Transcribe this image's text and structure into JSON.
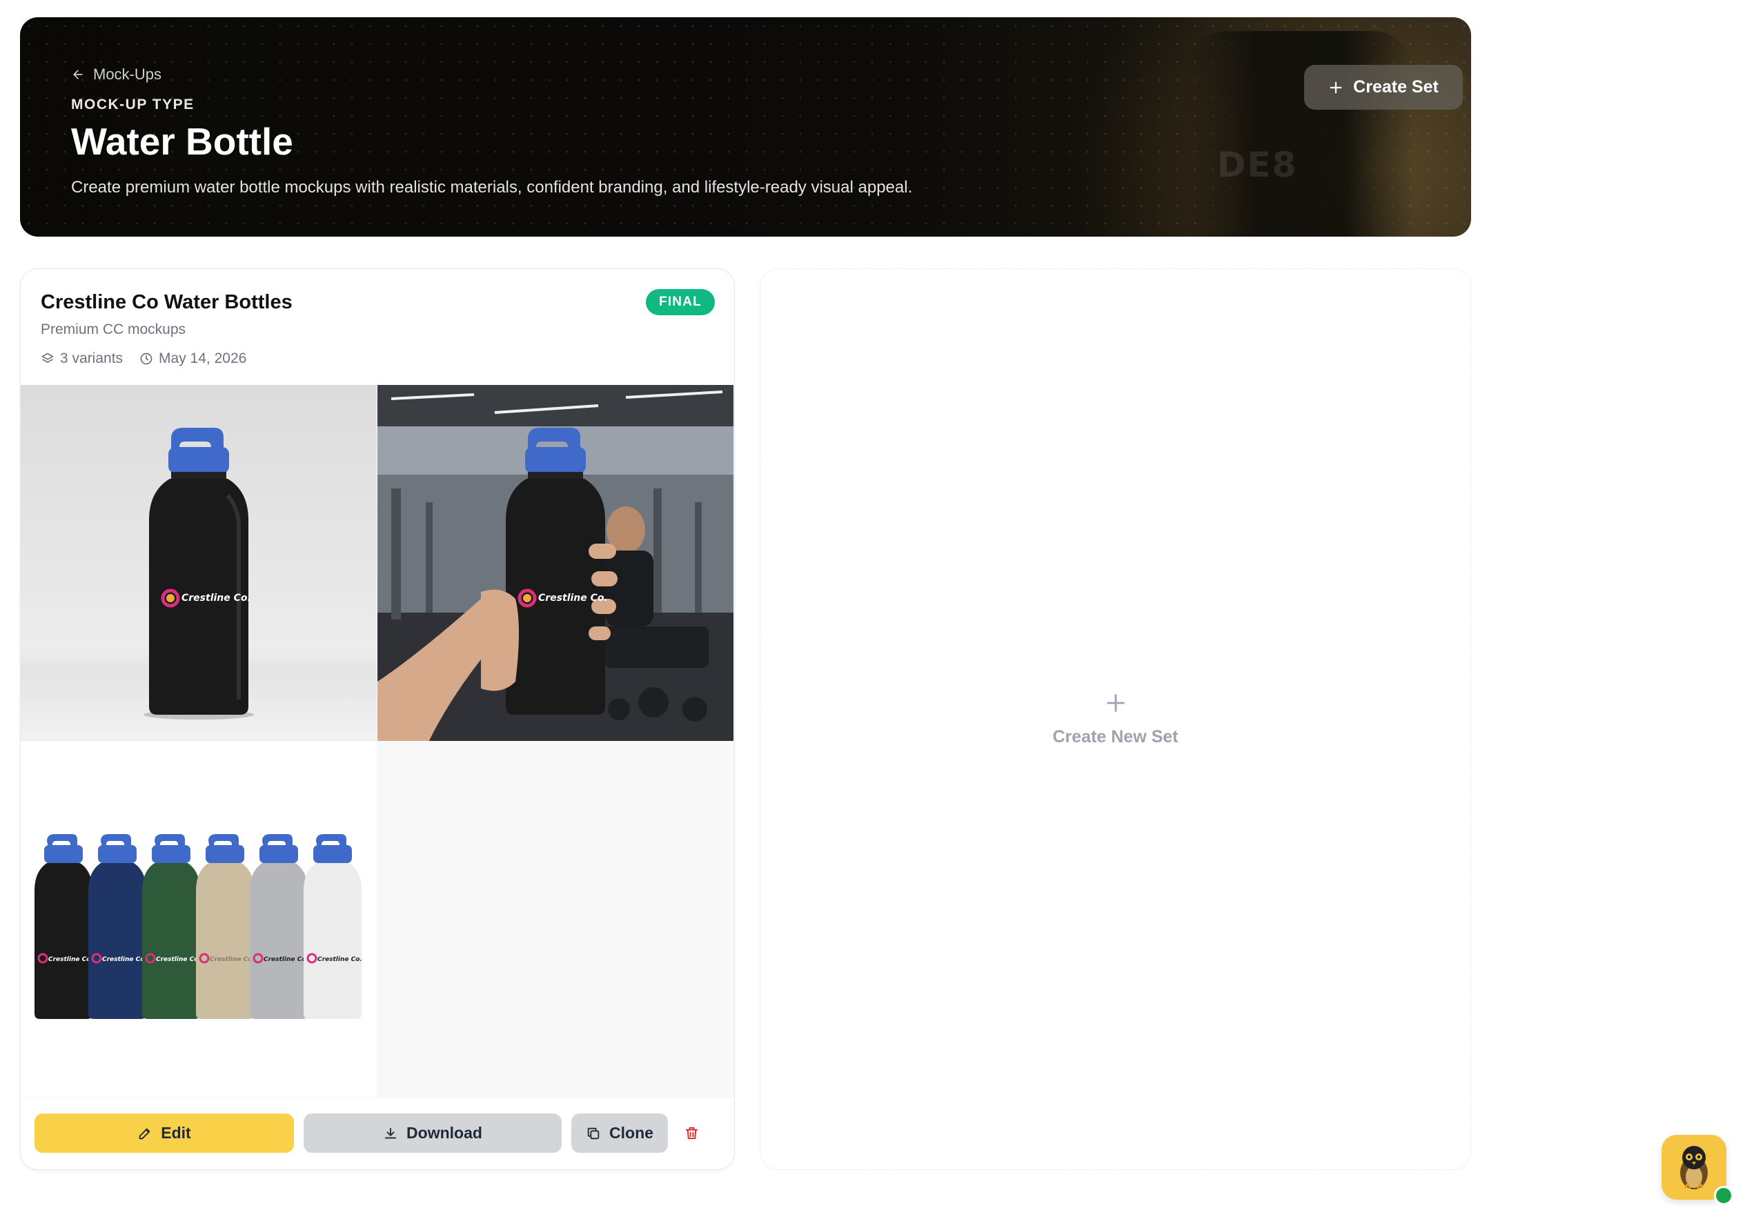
{
  "hero": {
    "back_label": "Mock-Ups",
    "eyebrow": "MOCK-UP TYPE",
    "title": "Water Bottle",
    "description": "Create premium water bottle mockups with realistic materials, confident branding, and lifestyle-ready visual appeal.",
    "create_button": "Create Set",
    "bg_logo_text": "DE8"
  },
  "set_card": {
    "title": "Crestline Co Water Bottles",
    "subtitle": "Premium CC mockups",
    "status": "FINAL",
    "variants": "3 variants",
    "date": "May 14, 2026",
    "brand_label": "Crestline Co.",
    "actions": {
      "edit": "Edit",
      "download": "Download",
      "clone": "Clone"
    }
  },
  "new_set": {
    "label": "Create New Set"
  },
  "colors": {
    "accent_yellow": "#f8d148",
    "status_green": "#10b981",
    "cap_blue": "#3f6ac9",
    "delete_red": "#dc2626"
  }
}
